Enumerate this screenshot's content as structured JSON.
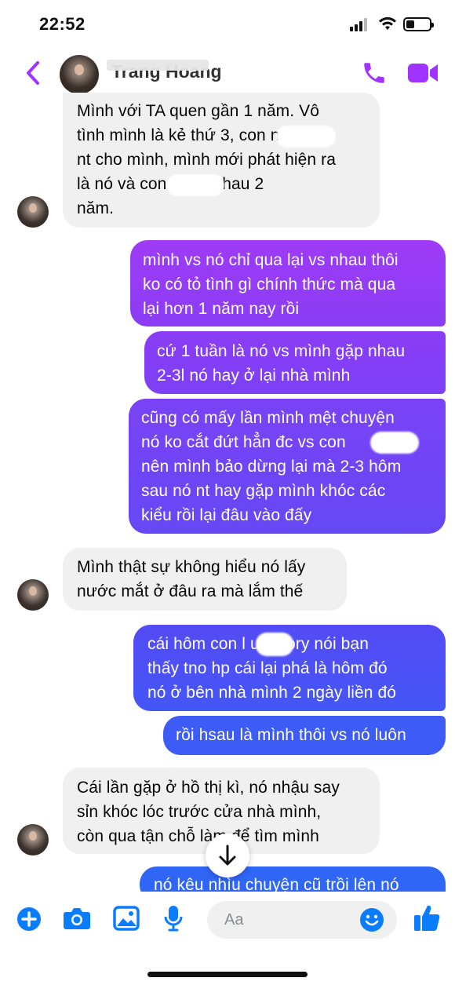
{
  "status_bar": {
    "time": "22:52"
  },
  "header": {
    "contact_name": "Trang Hoang"
  },
  "messages": [
    {
      "side": "in",
      "lines": [
        "Mình với TA quen gần 1 năm. Vô",
        "tình mình là kẻ thứ 3, con        n nó",
        "nt cho mình, mình mới phát hiện ra",
        "là nó và con          quen nhau 2",
        "năm."
      ]
    },
    {
      "side": "out",
      "lines": [
        "mình vs nó chỉ qua lại vs nhau thôi",
        "ko có tỏ tình gì chính thức mà qua",
        "lại hơn 1 năm nay rồi"
      ]
    },
    {
      "side": "out",
      "lines": [
        "cứ 1 tuần là nó vs mình gặp nhau",
        "2-3l nó hay ở lại nhà mình"
      ]
    },
    {
      "side": "out",
      "lines": [
        "cũng có mấy lần mình mệt chuyện",
        "nó ko cắt đứt hẳn đc vs con",
        "nên mình bảo dừng lại mà 2-3 hôm",
        "sau nó nt hay gặp mình khóc các",
        "kiểu rồi lại đâu vào đấy"
      ]
    },
    {
      "side": "in",
      "lines": [
        "Mình thật sự không hiểu nó lấy",
        "nước mắt ở đâu ra mà lắm thế"
      ]
    },
    {
      "side": "out",
      "lines": [
        "cái hôm con l       up story nói bạn",
        "thấy tno hp cái lại phá là hôm đó",
        "nó ở bên nhà mình 2 ngày liền đó"
      ]
    },
    {
      "side": "out",
      "lines": [
        "rồi hsau là mình thôi vs nó luôn"
      ]
    },
    {
      "side": "in",
      "lines": [
        "Cái lần gặp ở hồ thị kì, nó nhậu say",
        "sỉn khóc lóc trước cửa nhà mình,",
        "còn qua tận chỗ làm để tìm mình"
      ]
    },
    {
      "side": "out",
      "lines": [
        "nó kêu nhìu chuyện cũ trồi lên nó"
      ]
    }
  ],
  "composer": {
    "placeholder": "Aa"
  },
  "colors": {
    "accent": "#a033ff",
    "outgoing_top": "#9b3cf6",
    "outgoing_bottom": "#2f66f6",
    "incoming": "#f0f0f0",
    "composer_icon": "#0a7cff"
  },
  "icons": [
    "back-icon",
    "call-icon",
    "video-icon",
    "arrow-down-icon",
    "plus-icon",
    "camera-icon",
    "gallery-icon",
    "microphone-icon",
    "emoji-icon",
    "like-icon"
  ]
}
